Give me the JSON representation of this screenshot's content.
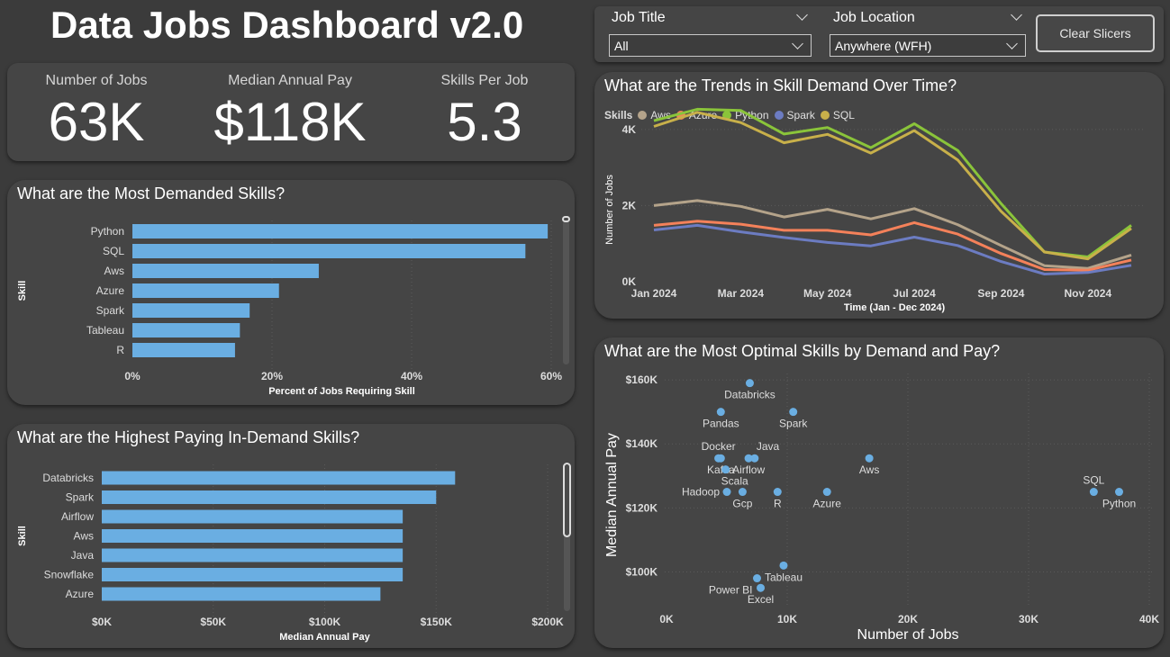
{
  "dashboard": {
    "title": "Data Jobs Dashboard v2.0"
  },
  "slicers": {
    "job_title_label": "Job Title",
    "job_title_value": "All",
    "job_location_label": "Job Location",
    "job_location_value": "Anywhere (WFH)",
    "clear_label": "Clear Slicers"
  },
  "kpis": [
    {
      "label": "Number of Jobs",
      "value": "63K"
    },
    {
      "label": "Median Annual Pay",
      "value": "$118K"
    },
    {
      "label": "Skills Per Job",
      "value": "5.3"
    }
  ],
  "colors": {
    "bar": "#6aaee2",
    "aws": "#b4a38a",
    "azure": "#f4815a",
    "python": "#8ac43a",
    "spark": "#6c7cc2",
    "sql": "#c8b04a",
    "dot": "#6aaee2"
  },
  "chart_data": [
    {
      "id": "demanded",
      "type": "bar",
      "orientation": "horizontal",
      "title": "What are the Most Demanded Skills?",
      "xlabel": "Percent of Jobs Requiring Skill",
      "ylabel": "Skill",
      "categories": [
        "Python",
        "SQL",
        "Aws",
        "Azure",
        "Spark",
        "Tableau",
        "R"
      ],
      "values": [
        59.5,
        56.3,
        26.7,
        21.0,
        16.8,
        15.4,
        14.7
      ],
      "xlim": [
        0,
        60
      ],
      "xticks": [
        0,
        20,
        40,
        60
      ],
      "xtick_labels": [
        "0%",
        "20%",
        "40%",
        "60%"
      ]
    },
    {
      "id": "paying",
      "type": "bar",
      "orientation": "horizontal",
      "title": "What are the Highest Paying In-Demand Skills?",
      "xlabel": "Median Annual Pay",
      "ylabel": "Skill",
      "categories": [
        "Databricks",
        "Spark",
        "Airflow",
        "Aws",
        "Java",
        "Snowflake",
        "Azure"
      ],
      "values": [
        158500,
        150000,
        135000,
        135000,
        135000,
        135000,
        125000
      ],
      "xlim": [
        0,
        200000
      ],
      "xticks": [
        0,
        50000,
        100000,
        150000,
        200000
      ],
      "xtick_labels": [
        "$0K",
        "$50K",
        "$100K",
        "$150K",
        "$200K"
      ]
    },
    {
      "id": "trends",
      "type": "line",
      "title": "What are the Trends in Skill Demand Over Time?",
      "xlabel": "Time (Jan - Dec 2024)",
      "ylabel": "Number of Jobs",
      "legend_title": "Skills",
      "legend_position": "top-left",
      "x": [
        "2024-01",
        "2024-02",
        "2024-03",
        "2024-04",
        "2024-05",
        "2024-06",
        "2024-07",
        "2024-08",
        "2024-09",
        "2024-10",
        "2024-11",
        "2024-12"
      ],
      "xticks": [
        "2024-01",
        "2024-03",
        "2024-05",
        "2024-07",
        "2024-09",
        "2024-11"
      ],
      "xtick_labels": [
        "Jan 2024",
        "Mar 2024",
        "May 2024",
        "Jul 2024",
        "Sep 2024",
        "Nov 2024"
      ],
      "ylim": [
        0,
        4800
      ],
      "yticks": [
        0,
        2000,
        4000
      ],
      "ytick_labels": [
        "0K",
        "2K",
        "4K"
      ],
      "series": [
        {
          "name": "Aws",
          "color_key": "aws",
          "values": [
            2000,
            2130,
            1980,
            1700,
            1900,
            1650,
            1920,
            1500,
            950,
            420,
            350,
            700
          ]
        },
        {
          "name": "Azure",
          "color_key": "azure",
          "values": [
            1480,
            1590,
            1510,
            1350,
            1350,
            1230,
            1550,
            1250,
            740,
            320,
            300,
            570
          ]
        },
        {
          "name": "Python",
          "color_key": "python",
          "values": [
            4230,
            4530,
            4500,
            3880,
            4050,
            3520,
            4150,
            3450,
            2050,
            780,
            650,
            1480
          ]
        },
        {
          "name": "Spark",
          "color_key": "spark",
          "values": [
            1360,
            1480,
            1310,
            1160,
            1030,
            940,
            1170,
            950,
            530,
            200,
            240,
            430
          ]
        },
        {
          "name": "SQL",
          "color_key": "sql",
          "values": [
            4080,
            4450,
            4180,
            3650,
            3870,
            3380,
            3970,
            3200,
            1850,
            780,
            600,
            1400
          ]
        }
      ]
    },
    {
      "id": "optimal",
      "type": "scatter",
      "title": "What are the Most Optimal Skills by Demand and Pay?",
      "xlabel": "Number of Jobs",
      "ylabel": "Median Annual Pay",
      "xlim": [
        0,
        40000
      ],
      "ylim": [
        90000,
        162000
      ],
      "xticks": [
        0,
        10000,
        20000,
        30000,
        40000
      ],
      "xtick_labels": [
        "0K",
        "10K",
        "20K",
        "30K",
        "40K"
      ],
      "yticks": [
        100000,
        120000,
        140000,
        160000
      ],
      "ytick_labels": [
        "$100K",
        "$120K",
        "$140K",
        "$160K"
      ],
      "points": [
        {
          "label": "Databricks",
          "x": 6900,
          "y": 159000,
          "label_pos": "below"
        },
        {
          "label": "Pandas",
          "x": 4500,
          "y": 150000,
          "label_pos": "below"
        },
        {
          "label": "Spark",
          "x": 10500,
          "y": 150000,
          "label_pos": "below"
        },
        {
          "label": "Docker",
          "x": 4300,
          "y": 135500,
          "label_pos": "above"
        },
        {
          "label": "Java",
          "x": 7300,
          "y": 135500,
          "label_pos": "above-right"
        },
        {
          "label": "Kafka",
          "x": 4500,
          "y": 135500,
          "label_pos": "below"
        },
        {
          "label": "Airflow",
          "x": 6800,
          "y": 135500,
          "label_pos": "below"
        },
        {
          "label": "Aws",
          "x": 16800,
          "y": 135500,
          "label_pos": "below"
        },
        {
          "label": "Scala",
          "x": 4900,
          "y": 132000,
          "label_pos": "below-right"
        },
        {
          "label": "Hadoop",
          "x": 5000,
          "y": 125000,
          "label_pos": "left"
        },
        {
          "label": "Gcp",
          "x": 6300,
          "y": 125000,
          "label_pos": "below"
        },
        {
          "label": "R",
          "x": 9200,
          "y": 125000,
          "label_pos": "below"
        },
        {
          "label": "Azure",
          "x": 13300,
          "y": 125000,
          "label_pos": "below"
        },
        {
          "label": "SQL",
          "x": 35400,
          "y": 125000,
          "label_pos": "above"
        },
        {
          "label": "Python",
          "x": 37500,
          "y": 125000,
          "label_pos": "below"
        },
        {
          "label": "Tableau",
          "x": 9700,
          "y": 102000,
          "label_pos": "below"
        },
        {
          "label": "Power BI",
          "x": 7500,
          "y": 98000,
          "label_pos": "below-left"
        },
        {
          "label": "Excel",
          "x": 7800,
          "y": 95000,
          "label_pos": "below"
        }
      ]
    }
  ]
}
